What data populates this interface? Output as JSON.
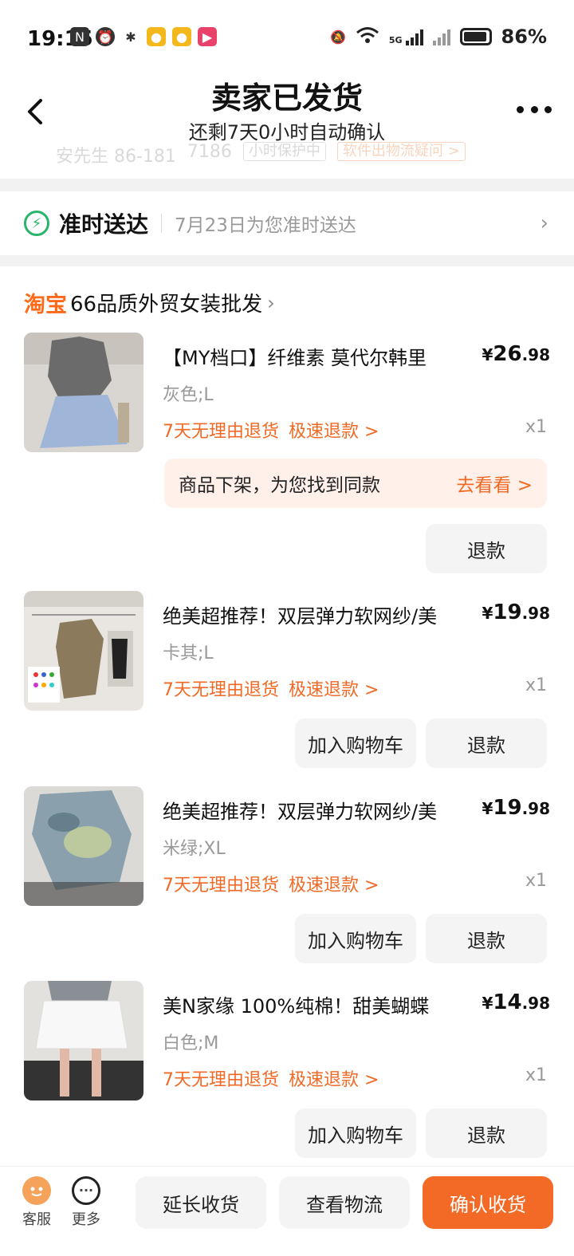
{
  "status_bar": {
    "time": "19:15",
    "battery": "86%",
    "network": "5G"
  },
  "header": {
    "title": "卖家已发货",
    "subtitle": "还剩7天0小时自动确认",
    "partial_row": [
      "安先生 86-181",
      "7186",
      "小时保护中",
      "软件出物流疑问 >"
    ]
  },
  "delivery": {
    "title": "准时送达",
    "text": "7月23日为您准时送达"
  },
  "shop": {
    "platform": "淘宝",
    "name": "66品质外贸女装批发"
  },
  "items": [
    {
      "title": "【MY档口】纤维素 莫代尔韩里",
      "price_int": "26",
      "price_dec": ".98",
      "currency": "¥",
      "spec": "灰色;L",
      "tag1": "7天无理由退货",
      "tag2": "极速退款 >",
      "qty": "x1",
      "note": "商品下架，为您找到同款",
      "note_action": "去看看 >",
      "btn_refund": "退款"
    },
    {
      "title": "绝美超推荐！双层弹力软网纱/美",
      "price_int": "19",
      "price_dec": ".98",
      "currency": "¥",
      "spec": "卡其;L",
      "tag1": "7天无理由退货",
      "tag2": "极速退款 >",
      "qty": "x1",
      "btn_cart": "加入购物车",
      "btn_refund": "退款"
    },
    {
      "title": "绝美超推荐！双层弹力软网纱/美",
      "price_int": "19",
      "price_dec": ".98",
      "currency": "¥",
      "spec": "米绿;XL",
      "tag1": "7天无理由退货",
      "tag2": "极速退款 >",
      "qty": "x1",
      "btn_cart": "加入购物车",
      "btn_refund": "退款"
    },
    {
      "title": "美N家缘 100%纯棉！甜美蝴蝶",
      "price_int": "14",
      "price_dec": ".98",
      "currency": "¥",
      "spec": "白色;M",
      "tag1": "7天无理由退货",
      "tag2": "极速退款 >",
      "qty": "x1",
      "btn_cart": "加入购物车",
      "btn_refund": "退款"
    }
  ],
  "bottom_bar": {
    "service": "客服",
    "more": "更多",
    "extend": "延长收货",
    "logistics": "查看物流",
    "confirm": "确认收货"
  },
  "colors": {
    "accent": "#f26a25",
    "green": "#2ab36b",
    "note_bg": "#fff1ea"
  }
}
